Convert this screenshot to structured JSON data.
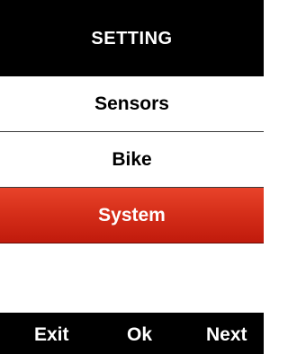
{
  "header": {
    "title": "SETTING"
  },
  "menu": {
    "items": [
      {
        "label": "Sensors",
        "selected": false
      },
      {
        "label": "Bike",
        "selected": false
      },
      {
        "label": "System",
        "selected": true
      }
    ]
  },
  "footer": {
    "exit_label": "Exit",
    "ok_label": "Ok",
    "next_label": "Next"
  },
  "colors": {
    "selected_background": "#d62f1a",
    "bar_background": "#000000"
  }
}
